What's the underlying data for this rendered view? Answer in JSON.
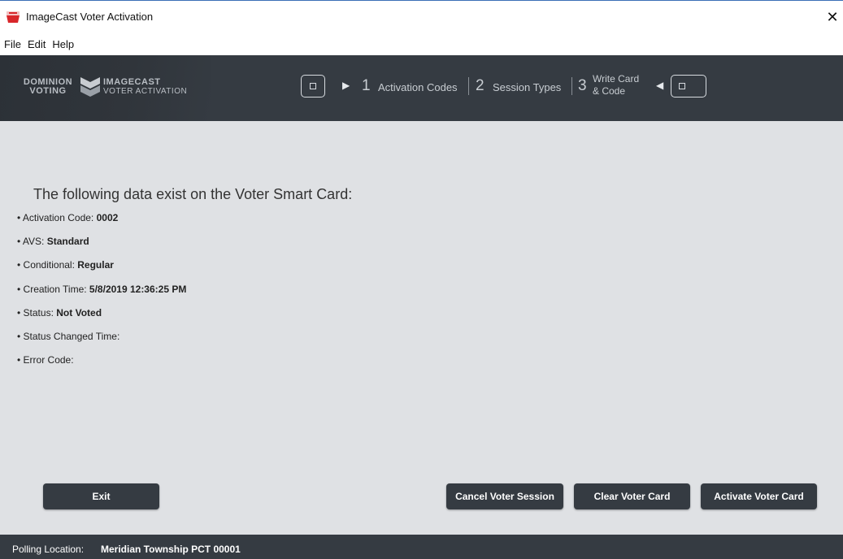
{
  "window": {
    "title": "ImageCast Voter Activation",
    "close_glyph": "✕"
  },
  "menu": [
    "File",
    "Edit",
    "Help"
  ],
  "logo": {
    "line1": "DOMINION",
    "line2": "VOTING",
    "line3": "IMAGECAST",
    "line4": "VOTER ACTIVATION"
  },
  "steps": [
    {
      "number": "1",
      "label": "Activation Codes"
    },
    {
      "number": "2",
      "label": "Session Types"
    },
    {
      "number": "3",
      "label_line1": "Write Card",
      "label_line2": "& Code"
    }
  ],
  "icons": {
    "card_left": "smart-card-icon",
    "arrow_right": "play-arrow-right-icon",
    "arrow_left": "play-arrow-left-icon",
    "card_right": "smart-card-icon"
  },
  "content": {
    "heading": "The following data exist on the Voter Smart Card:",
    "bullet": "•",
    "items": [
      {
        "label": "Activation Code:",
        "value": "0002"
      },
      {
        "label": "AVS:",
        "value": "Standard"
      },
      {
        "label": "Conditional:",
        "value": "Regular"
      },
      {
        "label": "Creation Time:",
        "value": "5/8/2019 12:36:25 PM"
      },
      {
        "label": "Status:",
        "value": "Not Voted"
      },
      {
        "label": "Status Changed Time:",
        "value": ""
      },
      {
        "label": "Error Code:",
        "value": ""
      }
    ]
  },
  "buttons": {
    "exit": "Exit",
    "cancel_session": "Cancel Voter Session",
    "clear_card": "Clear Voter Card",
    "activate_card": "Activate Voter Card"
  },
  "footer": {
    "label": "Polling Location:",
    "value": "Meridian Township PCT 00001"
  },
  "colors": {
    "header_bg": "#353b42",
    "content_bg": "#dfe1e4",
    "button_bg": "#353b42",
    "app_icon_red": "#d8262a"
  }
}
